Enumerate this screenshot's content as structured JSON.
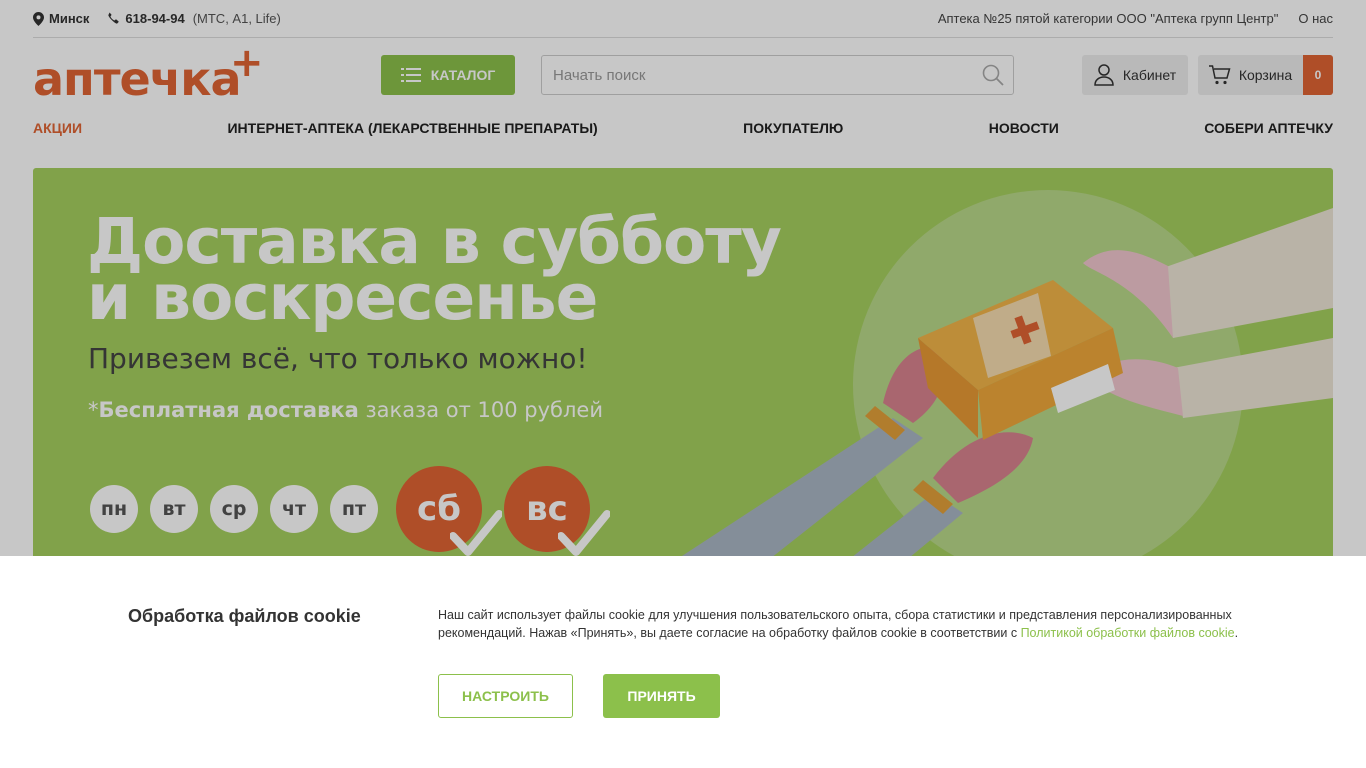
{
  "topbar": {
    "city": "Минск",
    "phone": "618-94-94",
    "phone_ops": "(МТС, A1, Life)",
    "pharmacy_info": "Аптека №25 пятой категории ООО \"Аптека групп Центр\"",
    "about": "О нас"
  },
  "header": {
    "logo_text": "аптечка",
    "logo_plus": "+",
    "catalog_label": "КАТАЛОГ",
    "search_placeholder": "Начать поиск",
    "cabinet_label": "Кабинет",
    "cart_label": "Корзина",
    "cart_count": "0"
  },
  "nav": {
    "items": [
      {
        "label": "АКЦИИ"
      },
      {
        "label": "ИНТЕРНЕТ-АПТЕКА (ЛЕКАРСТВЕННЫЕ ПРЕПАРАТЫ)"
      },
      {
        "label": "ПОКУПАТЕЛЮ"
      },
      {
        "label": "НОВОСТИ"
      },
      {
        "label": "СОБЕРИ АПТЕЧКУ"
      }
    ]
  },
  "banner": {
    "title_line1": "Доставка в субботу",
    "title_line2": "и воскресенье",
    "subtitle": "Привезем всё, что только можно!",
    "note_prefix": "*",
    "note_bold": "Бесплатная доставка",
    "note_rest": " заказа от 100 рублей",
    "days": [
      "пн",
      "вт",
      "ср",
      "чт",
      "пт"
    ],
    "weekend": [
      "сб",
      "вс"
    ]
  },
  "cookie": {
    "title": "Обработка файлов cookie",
    "text": "Наш сайт использует файлы cookie для улучшения пользовательского опыта, сбора статистики и представления персонализированных рекомендаций. Нажав «Принять», вы даете согласие на обработку файлов cookie в соответствии с ",
    "link": "Политикой обработки файлов cookie",
    "text_end": ".",
    "setup_label": "НАСТРОИТЬ",
    "accept_label": "ПРИНЯТЬ"
  },
  "colors": {
    "brand_orange": "#e06434",
    "brand_green": "#8cc04b",
    "banner_green": "#a6d05f"
  }
}
